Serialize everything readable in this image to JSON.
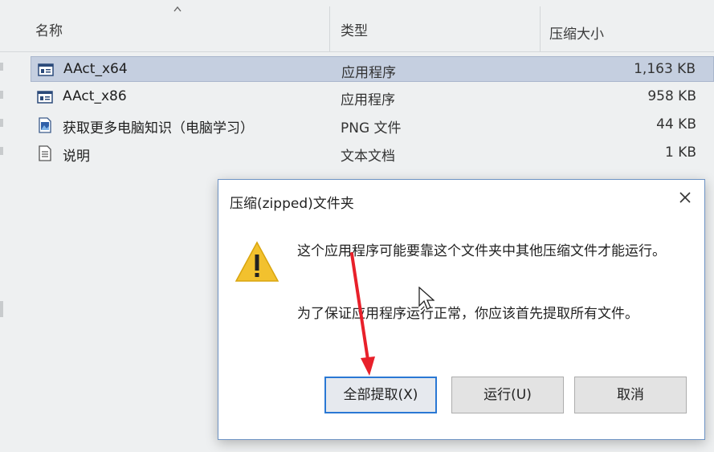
{
  "explorer": {
    "columns": {
      "name": "名称",
      "type": "类型",
      "size": "压缩大小"
    },
    "files": [
      {
        "name": "AAct_x64",
        "type": "应用程序",
        "size": "1,163 KB",
        "icon": "application-icon",
        "selected": true
      },
      {
        "name": "AAct_x86",
        "type": "应用程序",
        "size": "958 KB",
        "icon": "application-icon",
        "selected": false
      },
      {
        "name": "获取更多电脑知识（电脑学习）",
        "type": "PNG 文件",
        "size": "44 KB",
        "icon": "image-file-icon",
        "selected": false
      },
      {
        "name": "说明",
        "type": "文本文档",
        "size": "1 KB",
        "icon": "text-file-icon",
        "selected": false
      }
    ]
  },
  "dialog": {
    "title": "压缩(zipped)文件夹",
    "message1": "这个应用程序可能要靠这个文件夹中其他压缩文件才能运行。",
    "message2": "为了保证应用程序运行正常，你应该首先提取所有文件。",
    "buttons": {
      "extract_all": "全部提取(X)",
      "run": "运行(U)",
      "cancel": "取消"
    },
    "icon": "warning-icon"
  },
  "colors": {
    "accent": "#2a78d4",
    "selection": "#c5cfe0",
    "warning": "#f2c12e",
    "annotation_arrow": "#e8202a"
  }
}
